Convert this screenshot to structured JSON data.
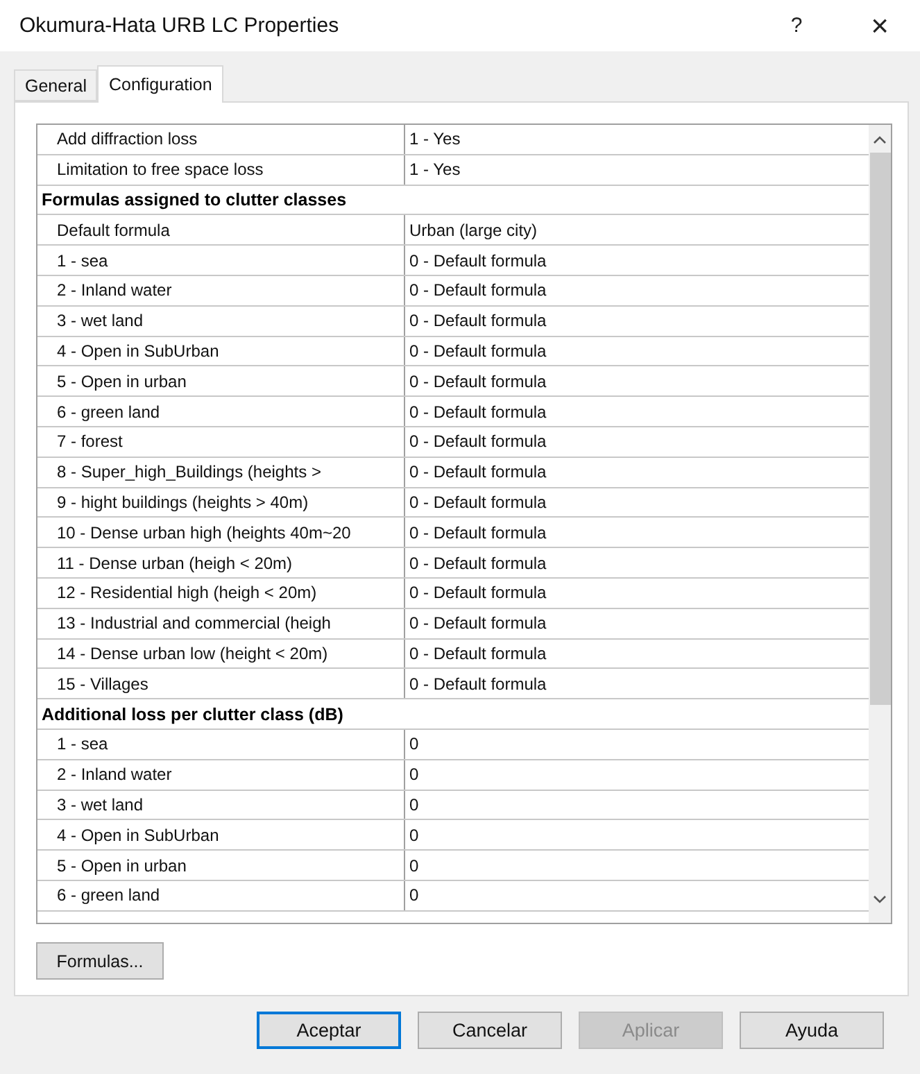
{
  "window": {
    "title": "Okumura-Hata URB LC Properties",
    "help": "?",
    "close": "×"
  },
  "tabs": [
    {
      "label": "General",
      "selected": false
    },
    {
      "label": "Configuration",
      "selected": true
    }
  ],
  "grid": {
    "rows": [
      {
        "kind": "property",
        "name": "Add diffraction loss",
        "value": "1 - Yes"
      },
      {
        "kind": "property",
        "name": "Limitation to free space loss",
        "value": "1 - Yes"
      },
      {
        "kind": "section",
        "title": "Formulas assigned to clutter classes"
      },
      {
        "kind": "property",
        "name": "Default formula",
        "value": "Urban (large city)"
      },
      {
        "kind": "property",
        "name": "1 - sea",
        "value": "0 - Default formula"
      },
      {
        "kind": "property",
        "name": "2 - Inland water",
        "value": "0 - Default formula"
      },
      {
        "kind": "property",
        "name": "3 - wet land",
        "value": "0 - Default formula"
      },
      {
        "kind": "property",
        "name": "4 - Open in SubUrban",
        "value": "0 - Default formula"
      },
      {
        "kind": "property",
        "name": "5 - Open in urban",
        "value": "0 - Default formula"
      },
      {
        "kind": "property",
        "name": "6 - green land",
        "value": "0 - Default formula"
      },
      {
        "kind": "property",
        "name": "7 - forest",
        "value": "0 - Default formula"
      },
      {
        "kind": "property",
        "name": "8 - Super_high_Buildings (heights >",
        "value": "0 - Default formula"
      },
      {
        "kind": "property",
        "name": "9 - hight buildings (heights > 40m)",
        "value": "0 - Default formula"
      },
      {
        "kind": "property",
        "name": "10 - Dense urban high (heights 40m~20",
        "value": "0 - Default formula"
      },
      {
        "kind": "property",
        "name": "11 - Dense urban  (heigh < 20m)",
        "value": "0 - Default formula"
      },
      {
        "kind": "property",
        "name": "12 - Residential high (heigh < 20m)",
        "value": "0 - Default formula"
      },
      {
        "kind": "property",
        "name": "13 - Industrial and commercial (heigh",
        "value": "0 - Default formula"
      },
      {
        "kind": "property",
        "name": "14 - Dense urban low (height < 20m)",
        "value": "0 - Default formula"
      },
      {
        "kind": "property",
        "name": "15 - Villages",
        "value": "0 - Default formula"
      },
      {
        "kind": "section",
        "title": "Additional loss per clutter class (dB)"
      },
      {
        "kind": "property",
        "name": "1 - sea",
        "value": "0"
      },
      {
        "kind": "property",
        "name": "2 - Inland water",
        "value": "0"
      },
      {
        "kind": "property",
        "name": "3 - wet land",
        "value": "0"
      },
      {
        "kind": "property",
        "name": "4 - Open in SubUrban",
        "value": "0"
      },
      {
        "kind": "property",
        "name": "5 - Open in urban",
        "value": "0"
      },
      {
        "kind": "property",
        "name": "6 - green land",
        "value": "0"
      }
    ]
  },
  "formulas_button": "Formulas...",
  "buttons": [
    {
      "label": "Aceptar",
      "default": true,
      "disabled": false
    },
    {
      "label": "Cancelar",
      "default": false,
      "disabled": false
    },
    {
      "label": "Aplicar",
      "default": false,
      "disabled": true
    },
    {
      "label": "Ayuda",
      "default": false,
      "disabled": false
    }
  ]
}
